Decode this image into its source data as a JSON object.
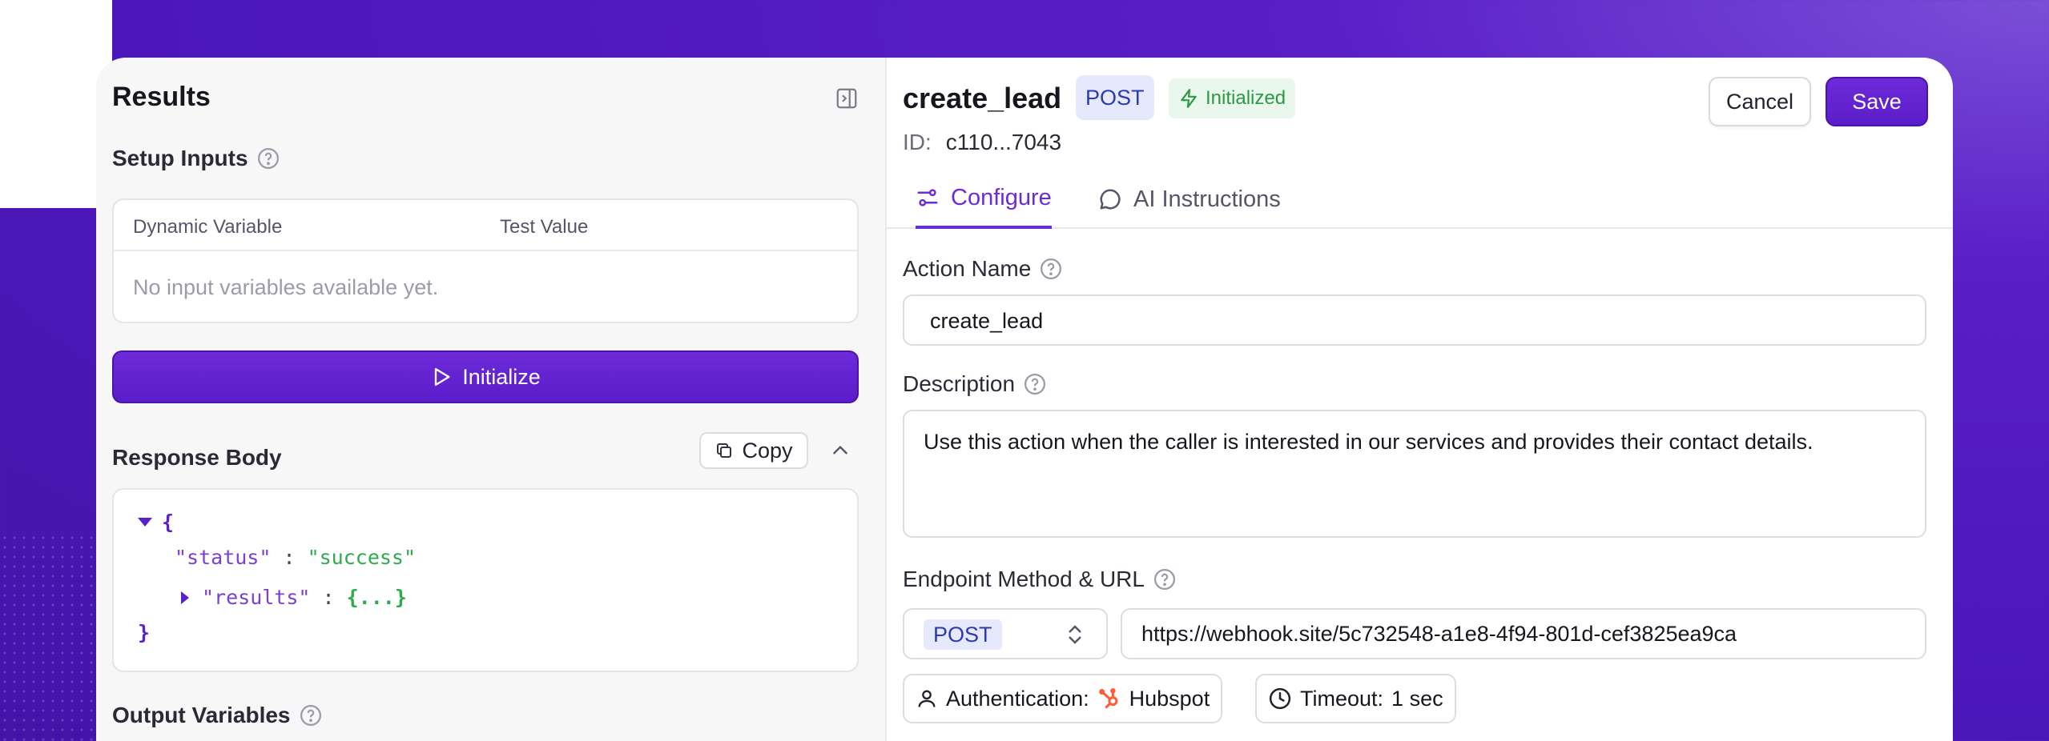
{
  "results_panel": {
    "title": "Results",
    "setup_inputs": {
      "title": "Setup Inputs",
      "columns": [
        "Dynamic Variable",
        "Test Value"
      ],
      "empty_text": "No input variables available yet."
    },
    "initialize_label": "Initialize",
    "response_body": {
      "title": "Response Body",
      "copy_label": "Copy",
      "json": {
        "open_brace": "{",
        "close_brace": "}",
        "status_key": "\"status\"",
        "status_value": "\"success\"",
        "results_key": "\"results\"",
        "collapsed": "{...}"
      }
    },
    "output_variables_title": "Output Variables"
  },
  "action": {
    "name": "create_lead",
    "method": "POST",
    "status": "Initialized",
    "id_label": "ID:",
    "id_value": "c110...7043",
    "cancel_label": "Cancel",
    "save_label": "Save",
    "tabs": [
      {
        "label": "Configure",
        "active": true
      },
      {
        "label": "AI Instructions",
        "active": false
      }
    ]
  },
  "form": {
    "action_name_label": "Action Name",
    "action_name_value": "create_lead",
    "description_label": "Description",
    "description_value": "Use this action when the caller is interested in our services and provides their contact details.",
    "endpoint_label": "Endpoint Method & URL",
    "endpoint_method": "POST",
    "endpoint_url": "https://webhook.site/5c732548-a1e8-4f94-801d-cef3825ea9ca",
    "auth_label": "Authentication:",
    "auth_value": "Hubspot",
    "timeout_label": "Timeout:",
    "timeout_value": "1 sec"
  },
  "colors": {
    "accent": "#6a2bd9",
    "background": "#4d17bd",
    "success": "#2b9a45",
    "json_key": "#7a3fd6",
    "json_string": "#2eaa4f"
  }
}
